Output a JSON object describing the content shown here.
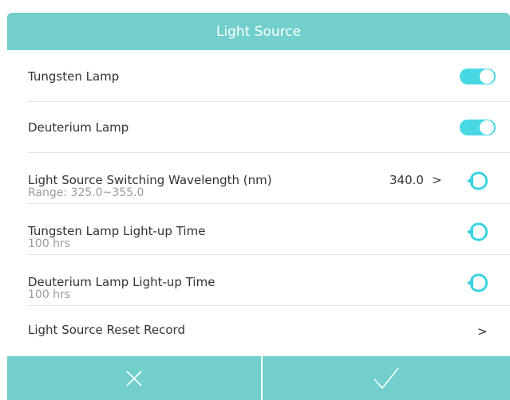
{
  "dialog": {
    "title": "Light Source"
  },
  "rows": [
    {
      "label": "Tungsten Lamp",
      "toggle_on": true
    },
    {
      "label": "Deuterium Lamp",
      "toggle_on": true
    },
    {
      "label": "Light Source Switching Wavelength (nm)",
      "sub": "Range: 325.0~355.0",
      "value": "340.0",
      "chevron": ">"
    },
    {
      "label": "Tungsten Lamp Light-up Time",
      "sub": "100 hrs"
    },
    {
      "label": "Deuterium Lamp Light-up Time",
      "sub": "100 hrs"
    },
    {
      "label": "Light Source Reset Record",
      "chevron": ">"
    }
  ],
  "colors": {
    "header": "#72cfcc",
    "toggle": "#48d8e3",
    "reset_icon": "#3ad3e0"
  },
  "icons": {
    "cancel": "close-icon",
    "confirm": "checkmark-icon",
    "reset": "reset-icon"
  }
}
